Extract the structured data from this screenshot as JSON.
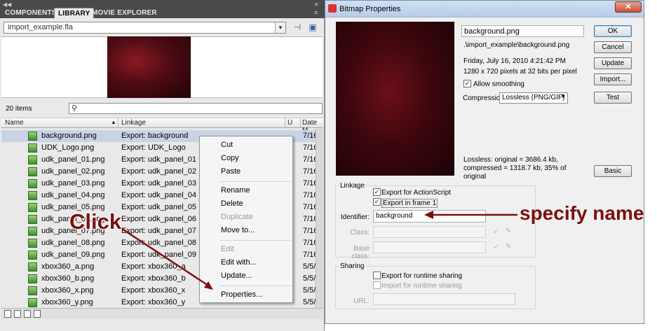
{
  "library": {
    "tabs": [
      "COMPONENTS",
      "LIBRARY",
      "MOVIE EXPLORER"
    ],
    "file": "import_example.fla",
    "item_count": "20 items",
    "columns": [
      "Name",
      "Linkage",
      "U",
      "Date M"
    ],
    "rows": [
      {
        "name": "background.png",
        "linkage": "Export: background",
        "u": "",
        "date": "7/16"
      },
      {
        "name": "UDK_Logo.png",
        "linkage": "Export: UDK_Logo",
        "u": "",
        "date": "7/16"
      },
      {
        "name": "udk_panel_01.png",
        "linkage": "Export: udk_panel_01",
        "u": "",
        "date": "7/16"
      },
      {
        "name": "udk_panel_02.png",
        "linkage": "Export: udk_panel_02",
        "u": "",
        "date": "7/16"
      },
      {
        "name": "udk_panel_03.png",
        "linkage": "Export: udk_panel_03",
        "u": "",
        "date": "7/16"
      },
      {
        "name": "udk_panel_04.png",
        "linkage": "Export: udk_panel_04",
        "u": "",
        "date": "7/16"
      },
      {
        "name": "udk_panel_05.png",
        "linkage": "Export: udk_panel_05",
        "u": "",
        "date": "7/16"
      },
      {
        "name": "udk_panel_06.png",
        "linkage": "Export: udk_panel_06",
        "u": "",
        "date": "7/16"
      },
      {
        "name": "udk_panel_07.png",
        "linkage": "Export: udk_panel_07",
        "u": "",
        "date": "7/16"
      },
      {
        "name": "udk_panel_08.png",
        "linkage": "Export: udk_panel_08",
        "u": "",
        "date": "7/16"
      },
      {
        "name": "udk_panel_09.png",
        "linkage": "Export: udk_panel_09",
        "u": "",
        "date": "7/16"
      },
      {
        "name": "xbox360_a.png",
        "linkage": "Export: xbox360_a",
        "u": "",
        "date": "5/5/"
      },
      {
        "name": "xbox360_b.png",
        "linkage": "Export: xbox360_b",
        "u": "",
        "date": "5/5/"
      },
      {
        "name": "xbox360_x.png",
        "linkage": "Export: xbox360_x",
        "u": "",
        "date": "5/5/"
      },
      {
        "name": "xbox360_y.png",
        "linkage": "Export: xbox360_y",
        "u": "",
        "date": "5/5/"
      }
    ]
  },
  "context_menu": {
    "items": [
      {
        "label": "Cut",
        "enabled": true
      },
      {
        "label": "Copy",
        "enabled": true
      },
      {
        "label": "Paste",
        "enabled": true
      },
      {
        "label": "Rename",
        "enabled": true
      },
      {
        "label": "Delete",
        "enabled": true
      },
      {
        "label": "Duplicate",
        "enabled": false
      },
      {
        "label": "Move to...",
        "enabled": true
      },
      {
        "label": "Edit",
        "enabled": false
      },
      {
        "label": "Edit with...",
        "enabled": true
      },
      {
        "label": "Update...",
        "enabled": true
      },
      {
        "label": "Properties...",
        "enabled": true
      }
    ]
  },
  "annotations": {
    "click": "Click",
    "specify": "specify name"
  },
  "dialog": {
    "title": "Bitmap Properties",
    "filename": "background.png",
    "path": ".\\import_example\\background.png",
    "date": "Friday, July 16, 2010  4:21:42 PM",
    "dimensions": "1280 x 720 pixels at 32 bits per pixel",
    "allow_smoothing": "Allow smoothing",
    "compression_label": "Compression:",
    "compression_value": "Lossless (PNG/GIF)",
    "lossless_info": "Lossless: original = 3686.4 kb, compressed = 1318.7 kb, 35% of original",
    "buttons": {
      "ok": "OK",
      "cancel": "Cancel",
      "update": "Update",
      "import": "Import...",
      "test": "Test",
      "basic": "Basic"
    },
    "linkage": {
      "heading": "Linkage",
      "export_as": "Export for ActionScript",
      "export_frame": "Export in frame 1",
      "identifier_label": "Identifier:",
      "identifier_value": "background",
      "class_label": "Class:",
      "base_class_label": "Base class:"
    },
    "sharing": {
      "heading": "Sharing",
      "export_runtime": "Export for runtime sharing",
      "import_runtime": "Import for runtime sharing",
      "url_label": "URL:"
    }
  }
}
